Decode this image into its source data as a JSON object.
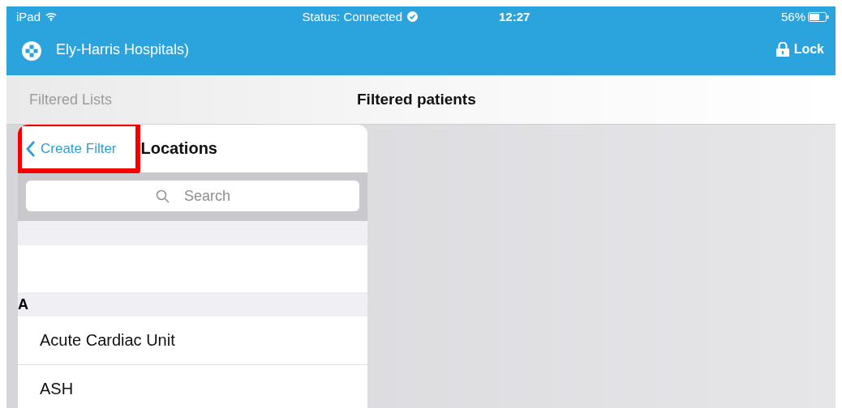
{
  "status_bar": {
    "device": "iPad",
    "status": "Status: Connected",
    "time": "12:27",
    "battery": "56%"
  },
  "header": {
    "title": "Ely-Harris Hospitals)",
    "lock_button": "Lock"
  },
  "nav_bar": {
    "left_title": "Filtered Lists",
    "title": "Filtered patients"
  },
  "popover": {
    "back_button": {
      "label": "Create Filter",
      "highlighted": true
    },
    "title": "Locations",
    "search": {
      "placeholder": "Search"
    },
    "sections": [
      {
        "letter": "A",
        "rows": [
          "Acute Cardiac Unit",
          "ASH"
        ]
      }
    ]
  }
}
